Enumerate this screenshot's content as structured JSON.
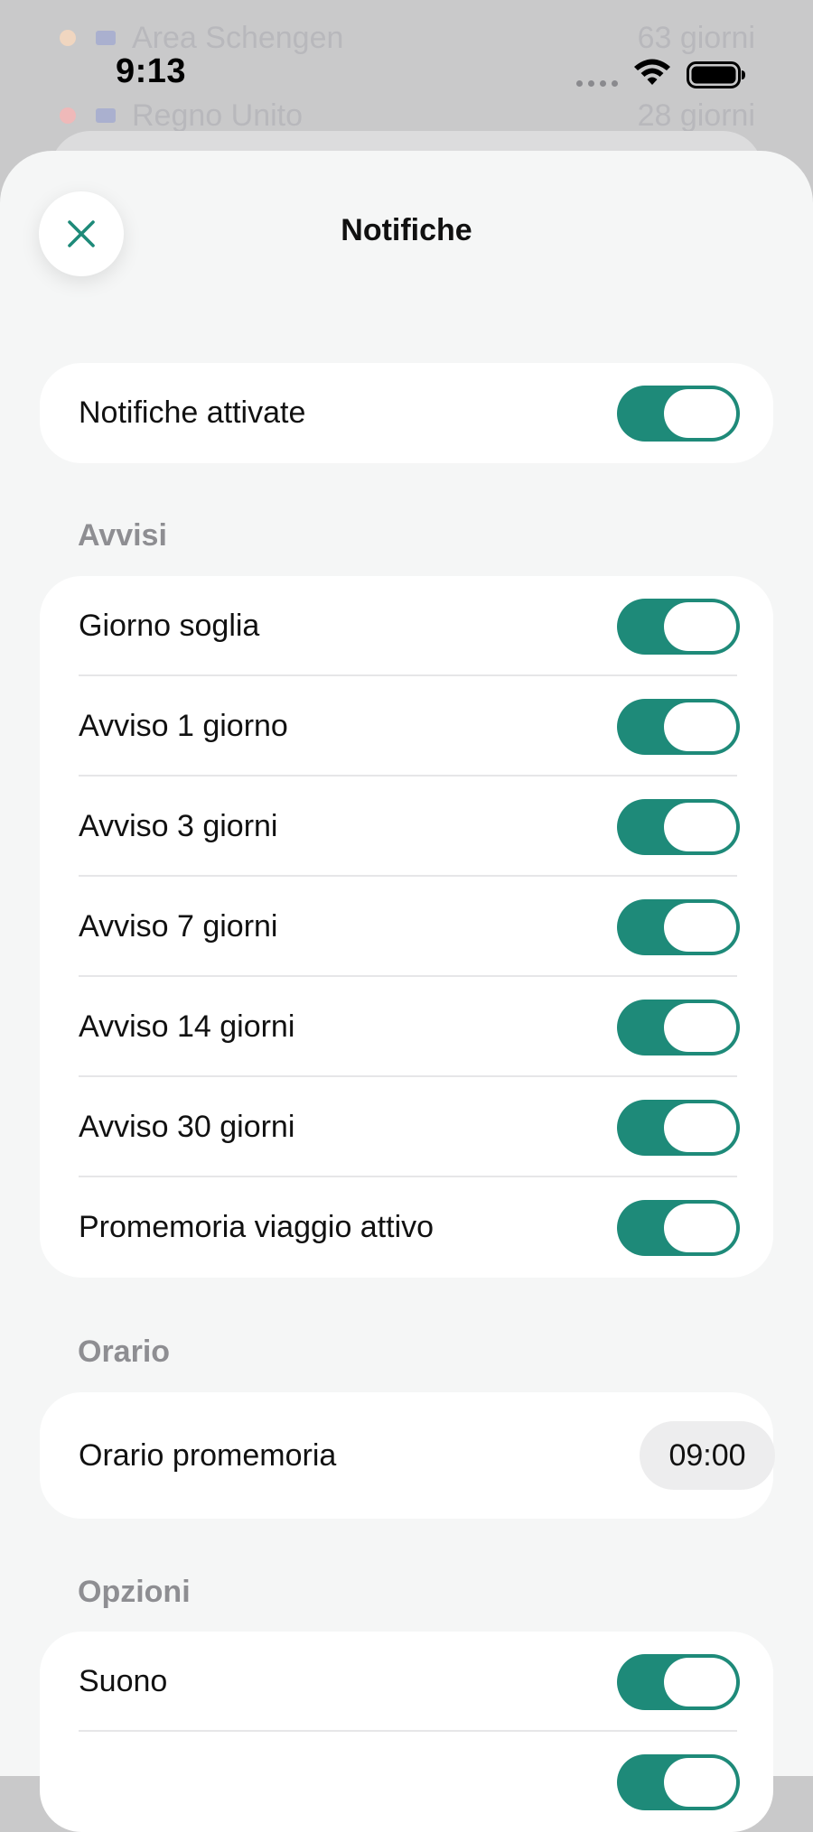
{
  "background": {
    "rows": [
      {
        "name": "Area Schengen",
        "value": "63 giorni",
        "dot_color": "#e8a66a",
        "flag_color": "#6b7ac7"
      },
      {
        "name": "Regno Unito",
        "value": "28 giorni",
        "dot_color": "#e06a6a",
        "flag_color": "#6b7ac7"
      }
    ]
  },
  "status_bar": {
    "time": "9:13",
    "signal_icon": "cellular-dots-icon",
    "wifi_icon": "wifi-icon",
    "battery_icon": "battery-icon"
  },
  "header": {
    "title": "Notifiche",
    "close_icon": "close-icon"
  },
  "colors": {
    "accent": "#1e8a79",
    "sheet_background": "#f5f6f6",
    "section_header": "#8e8e92"
  },
  "master": {
    "label": "Notifiche attivate",
    "on": true
  },
  "sections": {
    "avvisi": {
      "title": "Avvisi",
      "items": [
        {
          "label": "Giorno soglia",
          "on": true
        },
        {
          "label": "Avviso 1 giorno",
          "on": true
        },
        {
          "label": "Avviso 3 giorni",
          "on": true
        },
        {
          "label": "Avviso 7 giorni",
          "on": true
        },
        {
          "label": "Avviso 14 giorni",
          "on": true
        },
        {
          "label": "Avviso 30 giorni",
          "on": true
        },
        {
          "label": "Promemoria viaggio attivo",
          "on": true
        }
      ]
    },
    "orario": {
      "title": "Orario",
      "label": "Orario promemoria",
      "value": "09:00"
    },
    "opzioni": {
      "title": "Opzioni",
      "items": [
        {
          "label": "Suono",
          "on": true
        },
        {
          "label": "",
          "on": true
        }
      ]
    }
  }
}
